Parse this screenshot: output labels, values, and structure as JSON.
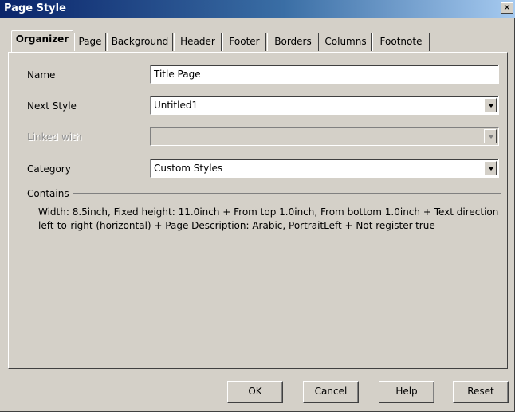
{
  "window": {
    "title": "Page Style",
    "close_glyph": "✕"
  },
  "tabs": [
    {
      "label": "Organizer",
      "active": true
    },
    {
      "label": "Page"
    },
    {
      "label": "Background"
    },
    {
      "label": "Header"
    },
    {
      "label": "Footer"
    },
    {
      "label": "Borders"
    },
    {
      "label": "Columns"
    },
    {
      "label": "Footnote"
    }
  ],
  "form": {
    "name": {
      "label": "Name",
      "value": "Title Page"
    },
    "next_style": {
      "label": "Next Style",
      "value": "Untitled1"
    },
    "linked_with": {
      "label": "Linked with",
      "value": "",
      "disabled": true
    },
    "category": {
      "label": "Category",
      "value": "Custom Styles"
    }
  },
  "contains": {
    "label": "Contains",
    "text": "Width: 8.5inch, Fixed height: 11.0inch + From top 1.0inch, From bottom 1.0inch + Text direction left-to-right (horizontal) + Page Description: Arabic, PortraitLeft + Not register-true"
  },
  "buttons": {
    "ok": "OK",
    "cancel": "Cancel",
    "help": "Help",
    "reset": "Reset"
  },
  "colors": {
    "dialog_bg": "#d4d0c8",
    "titlebar_start": "#0a246a",
    "titlebar_end": "#a6caf0"
  }
}
